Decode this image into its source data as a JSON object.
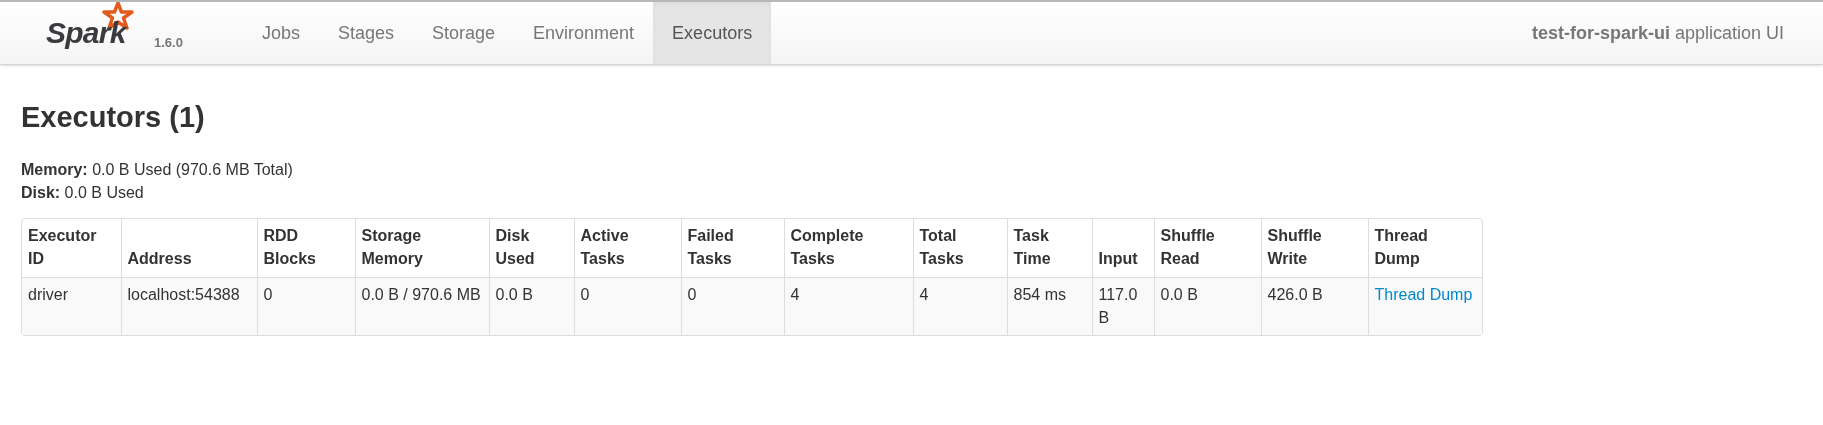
{
  "navbar": {
    "logo_text": "Spark",
    "version": "1.6.0",
    "tabs": [
      {
        "label": "Jobs",
        "selected": false
      },
      {
        "label": "Stages",
        "selected": false
      },
      {
        "label": "Storage",
        "selected": false
      },
      {
        "label": "Environment",
        "selected": false
      },
      {
        "label": "Executors",
        "selected": true
      }
    ],
    "app_name": "test-for-spark-ui",
    "app_suffix": "application UI"
  },
  "heading": "Executors (1)",
  "summary": [
    "**Memory:** 0.0 B Used (970.6 MB Total)",
    "**Disk:** 0.0 B Used"
  ],
  "table": {
    "columns": [
      "Executor ID",
      "Address",
      "RDD Blocks",
      "Storage Memory",
      "Disk Used",
      "Active Tasks",
      "Failed Tasks",
      "Complete Tasks",
      "Total Tasks",
      "Task Time",
      "Input",
      "Shuffle Read",
      "Shuffle Write",
      "Thread Dump"
    ],
    "rows": [
      [
        {
          "text": "driver"
        },
        {
          "text": "localhost:54388"
        },
        {
          "text": "0"
        },
        {
          "text": "0.0 B / 970.6 MB"
        },
        {
          "text": "0.0 B"
        },
        {
          "text": "0"
        },
        {
          "text": "0"
        },
        {
          "text": "4"
        },
        {
          "text": "4"
        },
        {
          "text": "854 ms"
        },
        {
          "text": "117.0 B"
        },
        {
          "text": "0.0 B"
        },
        {
          "text": "426.0 B"
        },
        {
          "text": "Thread Dump",
          "kind": "link"
        }
      ]
    ]
  }
}
